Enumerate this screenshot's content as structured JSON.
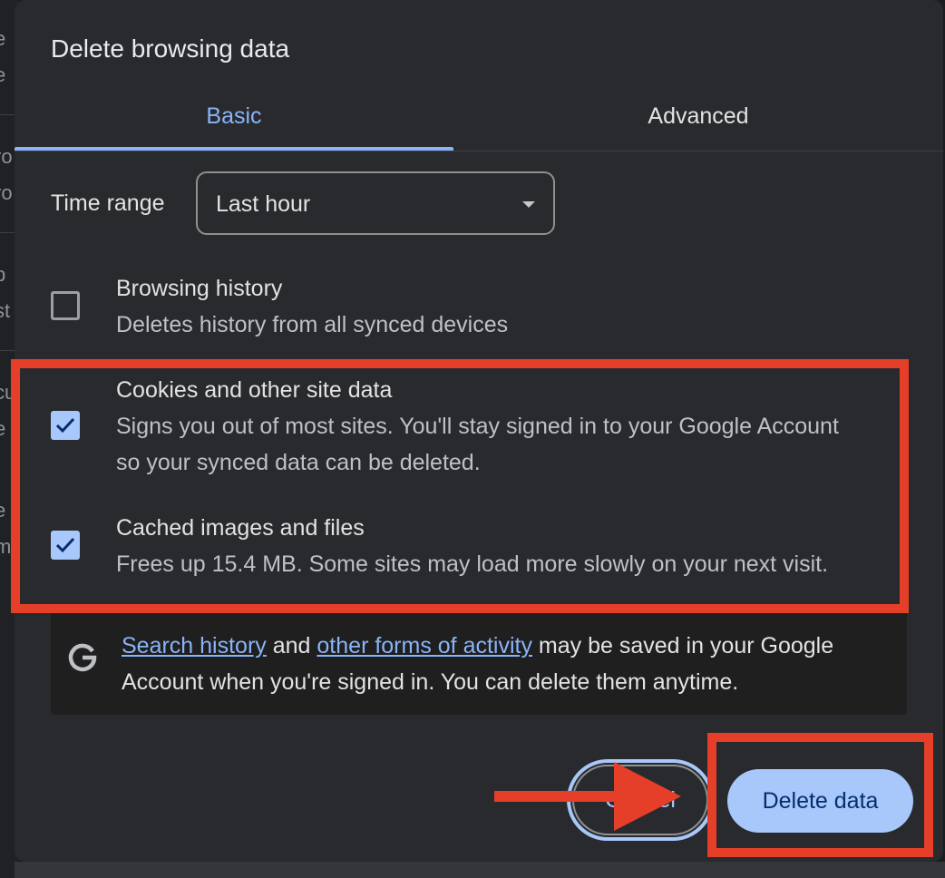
{
  "dialog": {
    "title": "Delete browsing data",
    "tabs": [
      {
        "label": "Basic",
        "selected": true
      },
      {
        "label": "Advanced",
        "selected": false
      }
    ],
    "time_range": {
      "label": "Time range",
      "value": "Last hour"
    },
    "options": [
      {
        "title": "Browsing history",
        "description": "Deletes history from all synced devices",
        "checked": false
      },
      {
        "title": "Cookies and other site data",
        "description": "Signs you out of most sites. You'll stay signed in to your Google Account so your synced data can be deleted.",
        "checked": true
      },
      {
        "title": "Cached images and files",
        "description": "Frees up 15.4 MB. Some sites may load more slowly on your next visit.",
        "checked": true
      }
    ],
    "info": {
      "link1": "Search history",
      "text1": " and ",
      "link2": "other forms of activity",
      "text2": " may be saved in your Google Account when you're signed in. You can delete them anytime.",
      "icon": "google-g-icon"
    },
    "buttons": {
      "cancel": "Cancel",
      "delete": "Delete data"
    }
  },
  "background_fragments": [
    "e",
    "e",
    "ro",
    "ro",
    "p",
    "st",
    "cu",
    "e",
    "e",
    "m"
  ],
  "colors": {
    "accent": "#8ab4f8",
    "primary_button": "#a8c7fa",
    "annotation": "#e53e29",
    "surface": "#292a2d"
  }
}
